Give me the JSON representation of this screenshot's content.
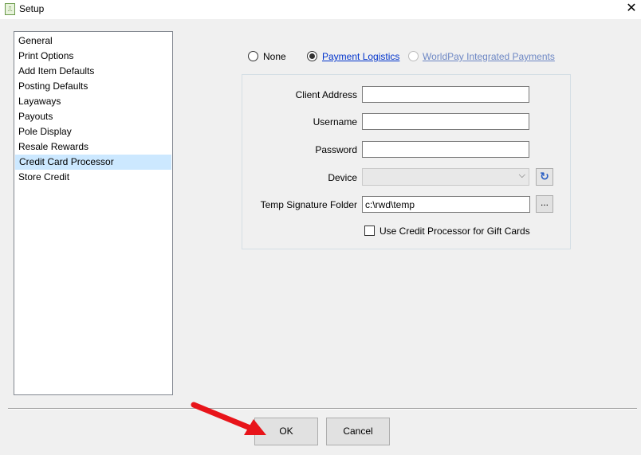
{
  "window": {
    "title": "Setup",
    "close_glyph": "✕",
    "app_icon_glyph": "⎍"
  },
  "sidebar": {
    "items": [
      {
        "label": "General"
      },
      {
        "label": "Print Options"
      },
      {
        "label": "Add Item Defaults"
      },
      {
        "label": "Posting Defaults"
      },
      {
        "label": "Layaways"
      },
      {
        "label": "Payouts"
      },
      {
        "label": "Pole Display"
      },
      {
        "label": "Resale Rewards"
      },
      {
        "label": "Credit Card Processor",
        "selected": true
      },
      {
        "label": "Store Credit"
      }
    ]
  },
  "processor": {
    "options": [
      {
        "label": "None",
        "selected": false,
        "enabled": true
      },
      {
        "label": "Payment Logistics",
        "selected": true,
        "enabled": true
      },
      {
        "label": "WorldPay Integrated Payments",
        "selected": false,
        "enabled": false
      }
    ]
  },
  "form": {
    "client_address": {
      "label": "Client Address",
      "value": ""
    },
    "username": {
      "label": "Username",
      "value": ""
    },
    "password": {
      "label": "Password",
      "value": ""
    },
    "device": {
      "label": "Device",
      "value": "",
      "enabled": false
    },
    "temp_folder": {
      "label": "Temp Signature Folder",
      "value": "c:\\rwd\\temp"
    },
    "gift_cards": {
      "label": "Use Credit Processor for Gift Cards",
      "checked": false
    },
    "browse_label": "...",
    "refresh_glyph": "↻",
    "chevron_glyph": "⌵"
  },
  "footer": {
    "ok_label": "OK",
    "cancel_label": "Cancel"
  },
  "colors": {
    "link": "#0033cc",
    "selection": "#cce8ff",
    "annotation_arrow": "#e8141a"
  }
}
